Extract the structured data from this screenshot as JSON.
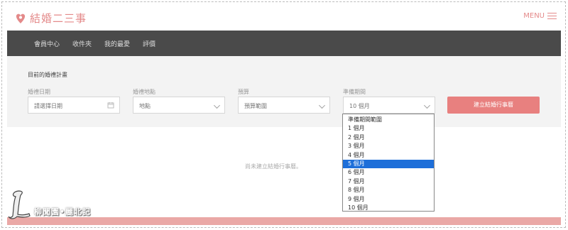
{
  "header": {
    "logo_text": "結婚二三事",
    "menu_label": "MENU"
  },
  "nav": {
    "items": [
      "會員中心",
      "收件夾",
      "我的最愛",
      "評價"
    ]
  },
  "plan": {
    "title": "目前的婚禮計畫",
    "fields": [
      {
        "label": "婚禮日期",
        "value": "請選擇日期",
        "icon": "calendar-icon"
      },
      {
        "label": "婚禮地點",
        "value": "地點"
      },
      {
        "label": "預算",
        "value": "預算範圍"
      },
      {
        "label": "準備期間",
        "value": "10 個月"
      }
    ],
    "cta_label": "建立結婚行事曆"
  },
  "empty_message": "尚未建立結婚行事曆。",
  "dropdown": {
    "options": [
      "準備期間範圍",
      "1 個月",
      "2 個月",
      "3 個月",
      "4 個月",
      "5 個月",
      "6 個月",
      "7 個月",
      "8 個月",
      "9 個月",
      "10 個月"
    ],
    "highlighted": "5 個月"
  },
  "watermark": {
    "text": "柳聞園•麗北記"
  },
  "colors": {
    "accent": "#e8807f",
    "nav_bg": "#4a4a4a",
    "highlight": "#1e6fd9"
  }
}
